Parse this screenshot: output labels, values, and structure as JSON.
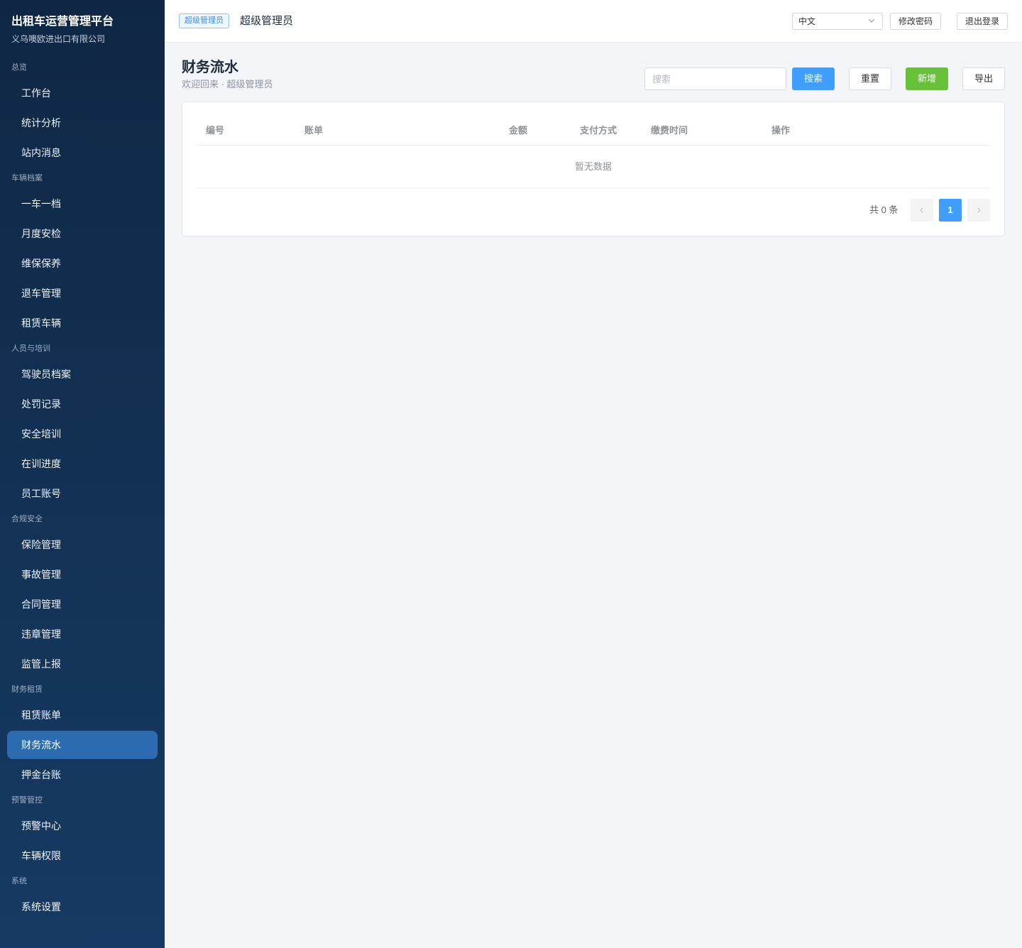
{
  "sidebar": {
    "title": "出租车运营管理平台",
    "subtitle": "义乌噢欧进出口有限公司",
    "groups": [
      {
        "label": "总览",
        "items": [
          {
            "label": "工作台"
          },
          {
            "label": "统计分析"
          },
          {
            "label": "站内消息"
          }
        ]
      },
      {
        "label": "车辆档案",
        "items": [
          {
            "label": "一车一档"
          },
          {
            "label": "月度安检"
          },
          {
            "label": "维保保养"
          },
          {
            "label": "退车管理"
          },
          {
            "label": "租赁车辆"
          }
        ]
      },
      {
        "label": "人员与培训",
        "items": [
          {
            "label": "驾驶员档案"
          },
          {
            "label": "处罚记录"
          },
          {
            "label": "安全培训"
          },
          {
            "label": "在训进度"
          },
          {
            "label": "员工账号"
          }
        ]
      },
      {
        "label": "合规安全",
        "items": [
          {
            "label": "保险管理"
          },
          {
            "label": "事故管理"
          },
          {
            "label": "合同管理"
          },
          {
            "label": "违章管理"
          },
          {
            "label": "监管上报"
          }
        ]
      },
      {
        "label": "财务租赁",
        "items": [
          {
            "label": "租赁账单"
          },
          {
            "label": "财务流水",
            "active": true
          },
          {
            "label": "押金台账"
          }
        ]
      },
      {
        "label": "预警管控",
        "items": [
          {
            "label": "预警中心"
          },
          {
            "label": "车辆权限"
          }
        ]
      },
      {
        "label": "系统",
        "items": [
          {
            "label": "系统设置"
          }
        ]
      }
    ]
  },
  "header": {
    "role_tag": "超级管理员",
    "role_name": "超级管理员",
    "language": "中文",
    "change_password": "修改密码",
    "logout": "退出登录"
  },
  "main": {
    "title": "财务流水",
    "subtitle": "欢迎回来 · 超级管理员",
    "search_placeholder": "搜索",
    "search_button": "搜索",
    "reset_button": "重置",
    "add_button": "新增",
    "export_button": "导出",
    "table": {
      "columns": [
        "编号",
        "账单",
        "金额",
        "支付方式",
        "缴费时间",
        "操作"
      ],
      "empty_text": "暂无数据"
    },
    "pagination": {
      "total_text": "共 0 条",
      "current_page": "1"
    }
  },
  "colors": {
    "primary": "#409eff",
    "success": "#67c23a",
    "sidebar_active": "#2d6bb1"
  }
}
